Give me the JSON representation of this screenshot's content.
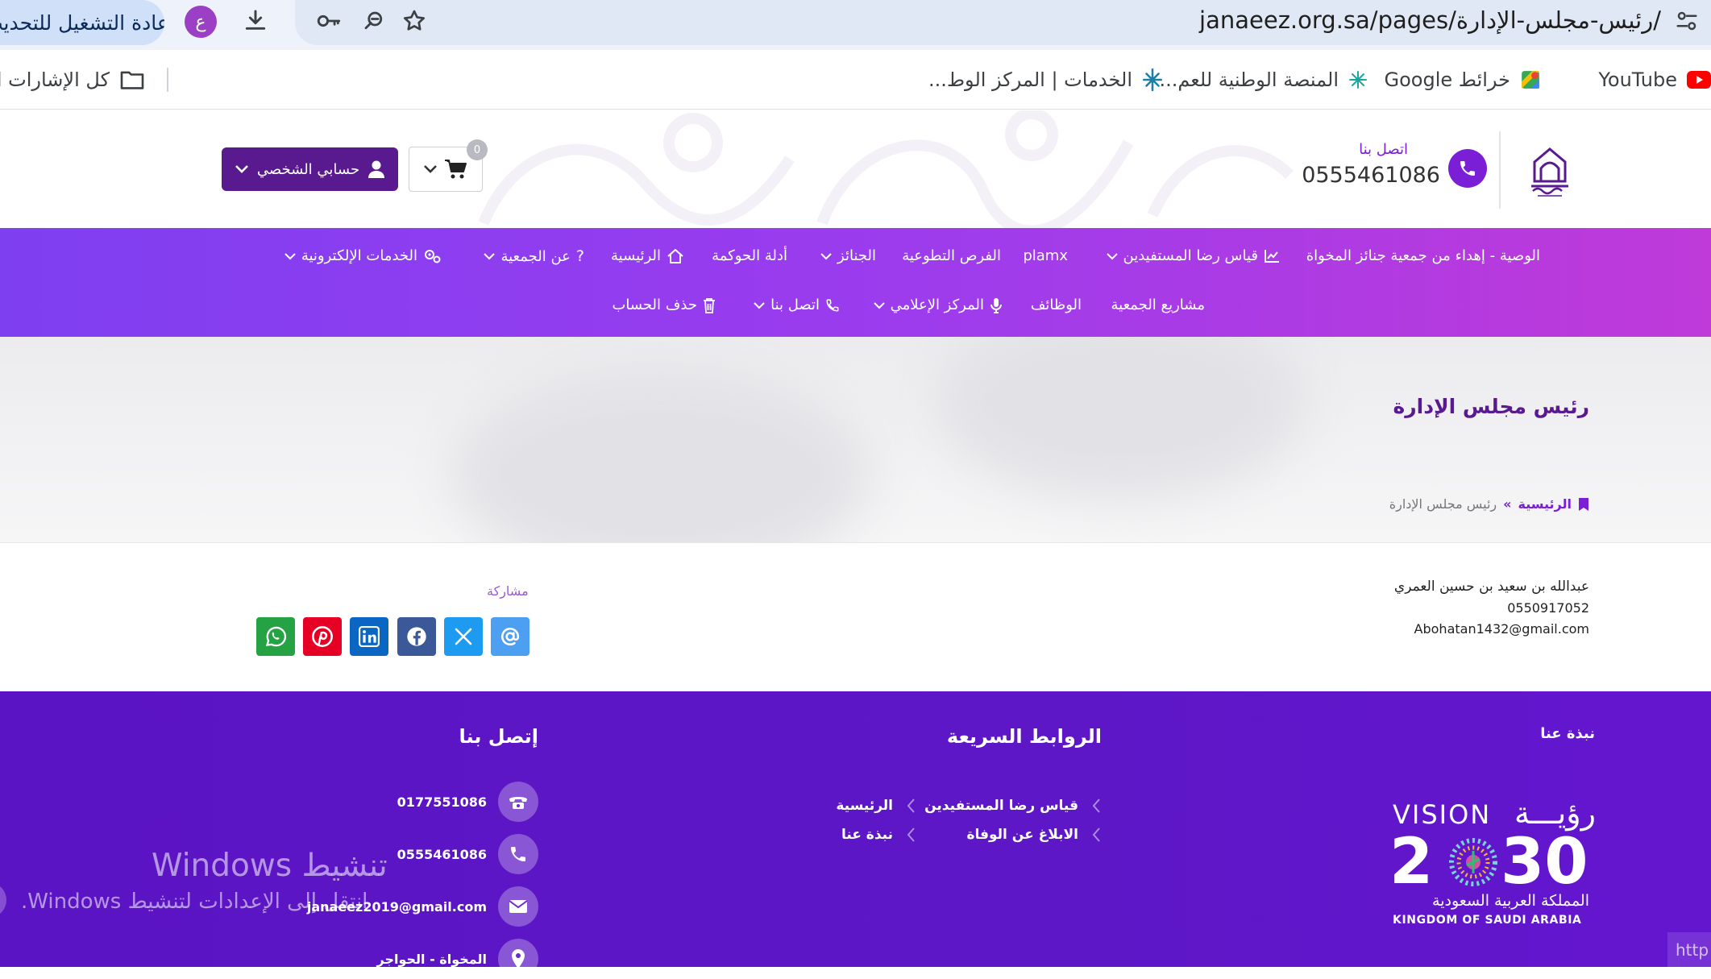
{
  "browser": {
    "url": "janaeez.org.sa/pages/رئيس-مجلس-الإدارة/",
    "relaunch_label": "إعادة التشغيل للتحديث",
    "profile_initial": "ع",
    "icons": [
      "tune-icon",
      "key-icon",
      "zoom-icon",
      "star-icon",
      "download-icon"
    ],
    "bookmarks": [
      {
        "label": "YouTube",
        "icon": "youtube-icon"
      },
      {
        "label": "خرائط Google",
        "icon": "maps-icon"
      },
      {
        "label": "المنصة الوطنية للعم...",
        "icon": "sparkle-icon"
      },
      {
        "label": "الخدمات | المركز الوط...",
        "icon": "sparkle-icon"
      },
      {
        "label": "كل الإشارات المرجعية",
        "icon": "folder-icon"
      }
    ]
  },
  "header": {
    "contact_label": "اتصل بنا",
    "contact_phone": "0555461086",
    "account_label": "حسابي الشخصي",
    "cart_count": "0"
  },
  "nav": {
    "row1": [
      {
        "label": "الوصية - إهداء من جمعية جنائز المخواة",
        "icon": "",
        "dropdown": false
      },
      {
        "label": "قياس رضا المستفيدين",
        "icon": "chart-icon",
        "dropdown": true
      },
      {
        "label": "plamx",
        "icon": "",
        "dropdown": false
      },
      {
        "label": "الفرص التطوعية",
        "icon": "",
        "dropdown": false
      },
      {
        "label": "الجنائز",
        "icon": "",
        "dropdown": true
      },
      {
        "label": "أدلة الحوكمة",
        "icon": "",
        "dropdown": false
      },
      {
        "label": "الرئيسية",
        "icon": "home-icon",
        "dropdown": false
      },
      {
        "label": "عن الجمعية",
        "icon": "question-icon",
        "dropdown": true
      },
      {
        "label": "الخدمات الإلكترونية",
        "icon": "gears-icon",
        "dropdown": true
      }
    ],
    "row2": [
      {
        "label": "مشاريع الجمعية",
        "icon": "",
        "dropdown": false
      },
      {
        "label": "الوظائف",
        "icon": "",
        "dropdown": false
      },
      {
        "label": "المركز الإعلامي",
        "icon": "mic-icon",
        "dropdown": true
      },
      {
        "label": "اتصل بنا",
        "icon": "phone-icon",
        "dropdown": true
      },
      {
        "label": "حذف الحساب",
        "icon": "trash-icon",
        "dropdown": false
      }
    ]
  },
  "page": {
    "title": "رئيس مجلس الإدارة",
    "breadcrumb_home": "الرئيسية",
    "breadcrumb_sep": "»",
    "breadcrumb_current": "رئيس مجلس الإدارة"
  },
  "person": {
    "name": "عبدالله بن سعيد بن حسين العمري",
    "phone": "0550917052",
    "email": "Abohatan1432@gmail.com"
  },
  "share": {
    "label": "مشاركة",
    "buttons": [
      {
        "name": "email",
        "color": "#4d9ff2"
      },
      {
        "name": "x",
        "color": "#1d9bf0"
      },
      {
        "name": "facebook",
        "color": "#3b5998"
      },
      {
        "name": "linkedin",
        "color": "#0a66c2"
      },
      {
        "name": "pinterest",
        "color": "#e60023"
      },
      {
        "name": "whatsapp",
        "color": "#25a244"
      }
    ]
  },
  "footer": {
    "about_title": "نبذة عنا",
    "links_title": "الروابط السريعة",
    "links": [
      "قياس رضا المستفيدين",
      "الرئيسية",
      "الابلاغ عن الوفاة",
      "نبذة عنا"
    ],
    "contact_title": "إتصل بنا",
    "contacts": [
      {
        "icon": "telephone-icon",
        "value": "0177551086"
      },
      {
        "icon": "mobile-phone-icon",
        "value": "0555461086"
      },
      {
        "icon": "envelope-icon",
        "value": "janaeez2019@gmail.com"
      },
      {
        "icon": "location-icon",
        "value": "المخواة - الحواجر"
      }
    ],
    "vision": {
      "word": "رؤيـــة",
      "latin": "VISION",
      "year_left": "2",
      "year_right": "30",
      "arabic_country": "المملكة العربية السعودية",
      "english_country": "KINGDOM OF SAUDI ARABIA"
    }
  },
  "overlay": {
    "windows_title": "تنشيط Windows",
    "windows_sub": "انتقل إلى الإعدادات لتنشيط Windows.",
    "corner_text": "http"
  },
  "colors": {
    "brand_purple": "#5a1a8f",
    "accent_purple": "#7b1fd6",
    "footer_bg": "#5b14c4"
  }
}
